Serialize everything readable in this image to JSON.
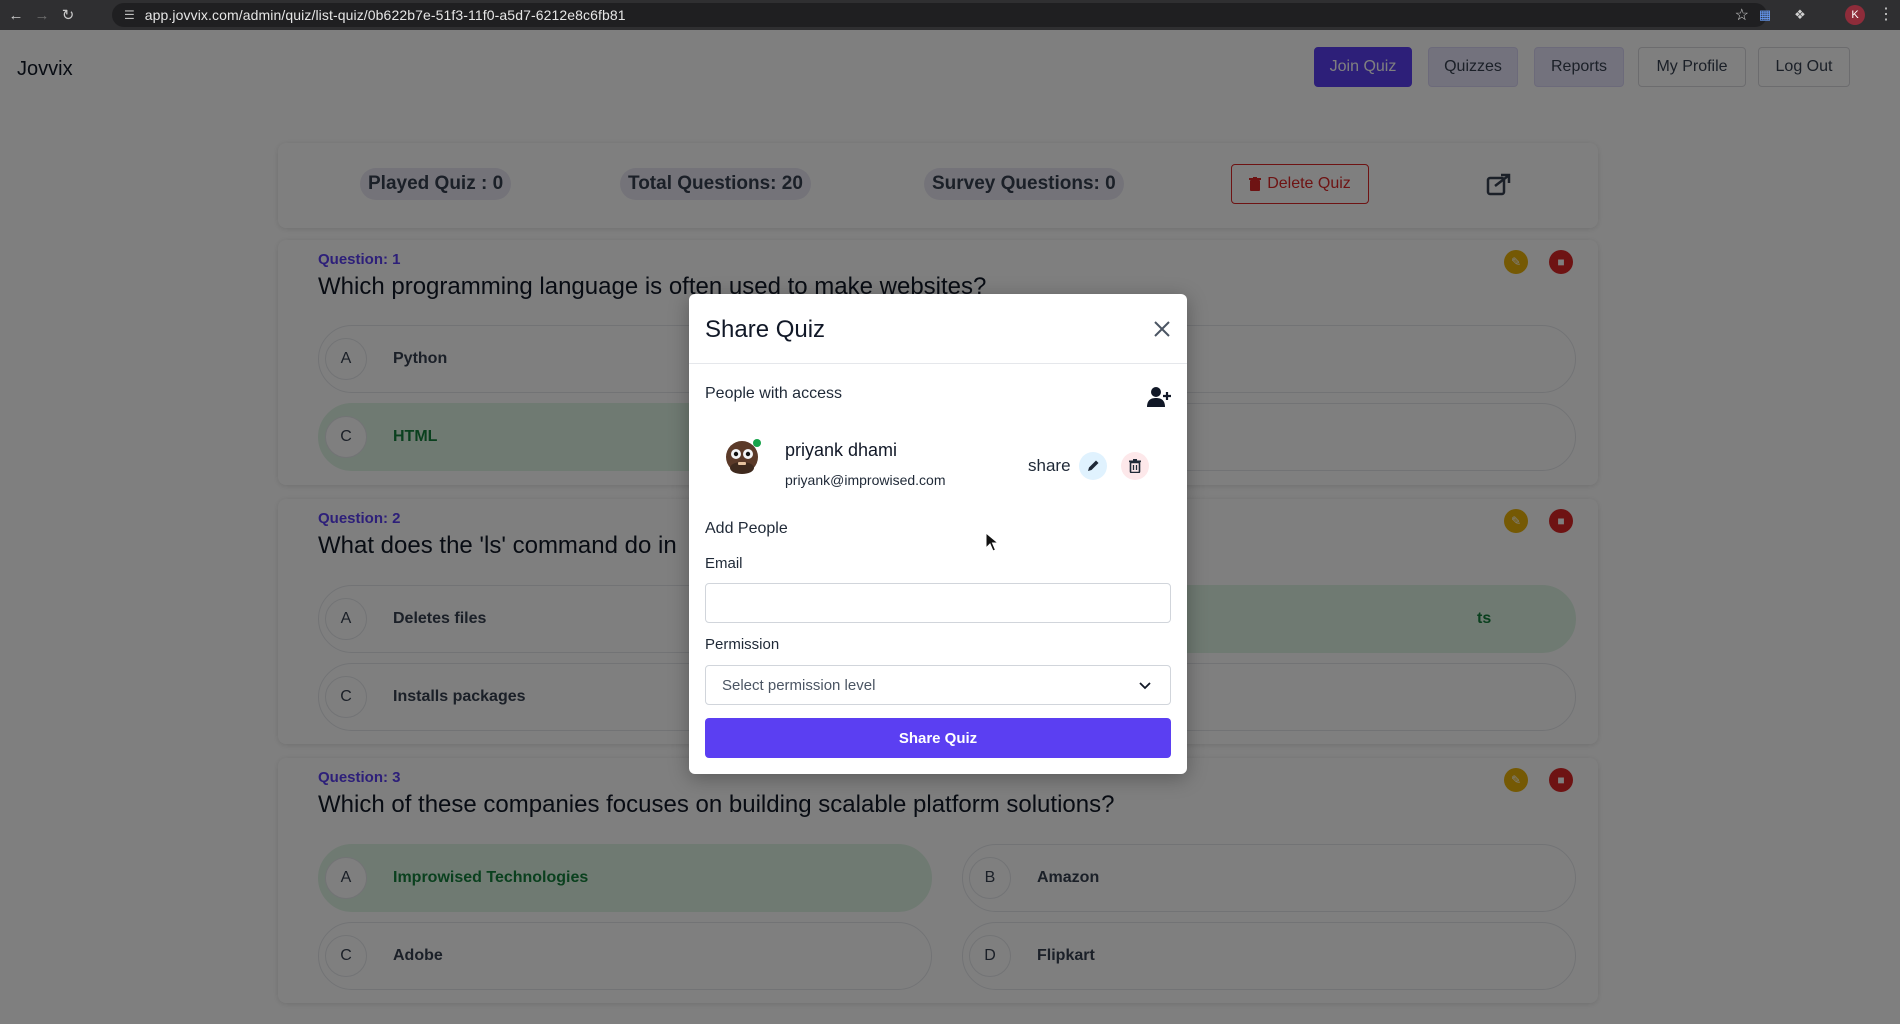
{
  "browser": {
    "url": "app.jovvix.com/admin/quiz/list-quiz/0b622b7e-51f3-11f0-a5d7-6212e8c6fb81",
    "profile_initial": "K"
  },
  "header": {
    "brand": "Jovvix",
    "nav": {
      "join_quiz": "Join Quiz",
      "quizzes": "Quizzes",
      "reports": "Reports",
      "my_profile": "My Profile",
      "log_out": "Log Out"
    }
  },
  "stats": {
    "played_quiz": "Played Quiz : 0",
    "total_questions": "Total Questions: 20",
    "survey_questions": "Survey Questions: 0",
    "delete_quiz": "Delete Quiz"
  },
  "questions": [
    {
      "number": "Question: 1",
      "text": "Which programming language is often used to make websites?",
      "options": [
        {
          "letter": "A",
          "text": "Python",
          "correct": false
        },
        {
          "letter": "C",
          "text": "HTML",
          "correct": true
        }
      ]
    },
    {
      "number": "Question: 2",
      "text": "What does the 'ls' command do in",
      "options": [
        {
          "letter": "A",
          "text": "Deletes files",
          "correct": false
        },
        {
          "letter": "C",
          "text": "Installs packages",
          "correct": false
        },
        {
          "letter": "",
          "text": "ts",
          "correct": true
        }
      ]
    },
    {
      "number": "Question: 3",
      "text": "Which of these companies focuses on building scalable platform solutions?",
      "options": [
        {
          "letter": "A",
          "text": "Improwised Technologies",
          "correct": true
        },
        {
          "letter": "B",
          "text": "Amazon",
          "correct": false
        },
        {
          "letter": "C",
          "text": "Adobe",
          "correct": false
        },
        {
          "letter": "D",
          "text": "Flipkart",
          "correct": false
        }
      ]
    }
  ],
  "modal": {
    "title": "Share Quiz",
    "people_with_access": "People with access",
    "person": {
      "name": "priyank dhami",
      "email": "priyank@improwised.com",
      "permission": "share"
    },
    "add_people": "Add People",
    "email_label": "Email",
    "email_value": "",
    "permission_label": "Permission",
    "permission_placeholder": "Select permission level",
    "submit": "Share Quiz"
  },
  "colors": {
    "primary": "#5b3ff2",
    "danger": "#dc2626",
    "edit": "#eab308",
    "correct_bg": "#dff5e5",
    "correct_text": "#15803d"
  }
}
